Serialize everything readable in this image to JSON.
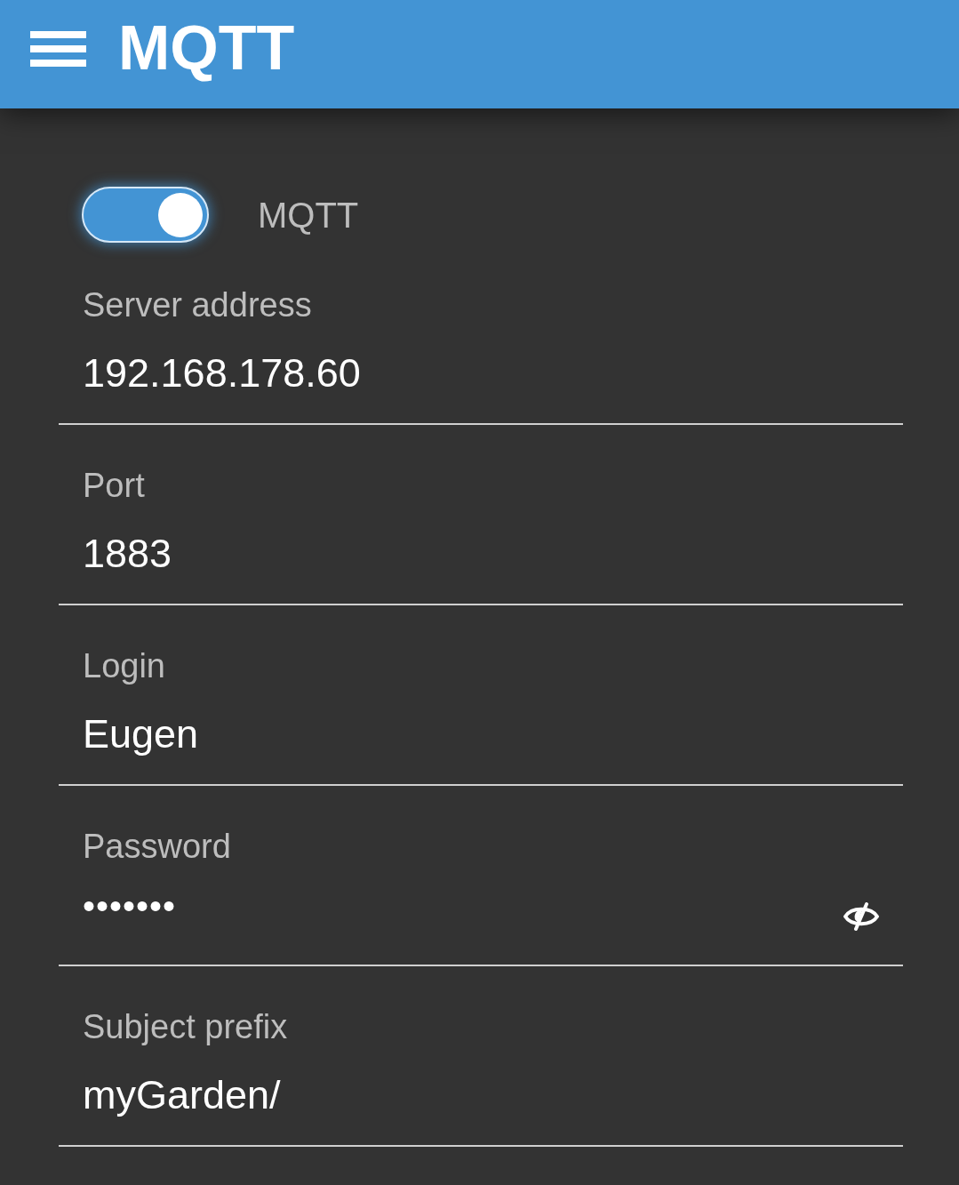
{
  "app_bar": {
    "title": "MQTT"
  },
  "mqtt_switch": {
    "label": "MQTT",
    "on": true
  },
  "fields": [
    {
      "label": "Server address",
      "value": "192.168.178.60",
      "kind": "text"
    },
    {
      "label": "Port",
      "value": "1883",
      "kind": "text"
    },
    {
      "label": "Login",
      "value": "Eugen",
      "kind": "text"
    },
    {
      "label": "Password",
      "value": "•••••••",
      "kind": "password"
    },
    {
      "label": "Subject prefix",
      "value": "myGarden/",
      "kind": "text"
    }
  ]
}
